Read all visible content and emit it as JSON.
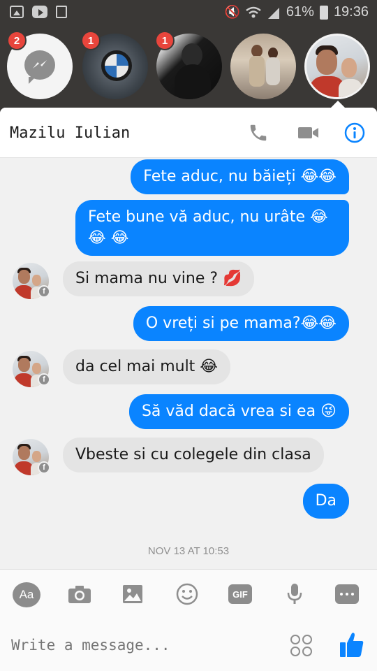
{
  "status_bar": {
    "battery_percent": "61%",
    "time": "19:36",
    "icons": [
      "gallery-icon",
      "youtube-icon",
      "shopping-bag-icon",
      "mute-icon",
      "wifi-icon",
      "signal-icon",
      "battery-icon"
    ]
  },
  "chat_heads": [
    {
      "name": "messenger",
      "badge": "2"
    },
    {
      "name": "bmw",
      "badge": "1"
    },
    {
      "name": "dark-photo",
      "badge": "1"
    },
    {
      "name": "kids-photo",
      "badge": ""
    },
    {
      "name": "selfie",
      "badge": ""
    }
  ],
  "header": {
    "contact_name": "Mazilu Iulian",
    "icons": [
      "phone-icon",
      "video-camera-icon",
      "info-icon"
    ],
    "accent_color": "#0a84ff"
  },
  "messages": [
    {
      "direction": "out",
      "text": "Fete aduc, nu băieți 😂😂"
    },
    {
      "direction": "out",
      "text": "Fete bune vă aduc, nu urâte 😂😂 😂"
    },
    {
      "direction": "in",
      "text": "Si mama nu vine ? 💋"
    },
    {
      "direction": "out",
      "text": "O vreți si pe mama?😂😂"
    },
    {
      "direction": "in",
      "text": "da cel mai mult 😂"
    },
    {
      "direction": "out",
      "text": "Să văd dacă vrea si ea 😜"
    },
    {
      "direction": "in",
      "text": "Vbeste si cu colegele din clasa"
    },
    {
      "direction": "out",
      "text": "Da"
    }
  ],
  "timestamp": "NOV 13 AT 10:53",
  "composer": {
    "aa_label": "Aa",
    "gif_label": "GIF",
    "placeholder": "Write a message...",
    "tools": [
      "aa-button",
      "camera-icon",
      "gallery-icon",
      "emoji-icon",
      "gif-button",
      "microphone-icon",
      "more-icon"
    ],
    "like_icon": "thumbs-up-icon"
  },
  "colors": {
    "outgoing_bubble": "#0a84ff",
    "incoming_bubble": "#e4e4e4",
    "badge": "#e8453c"
  }
}
